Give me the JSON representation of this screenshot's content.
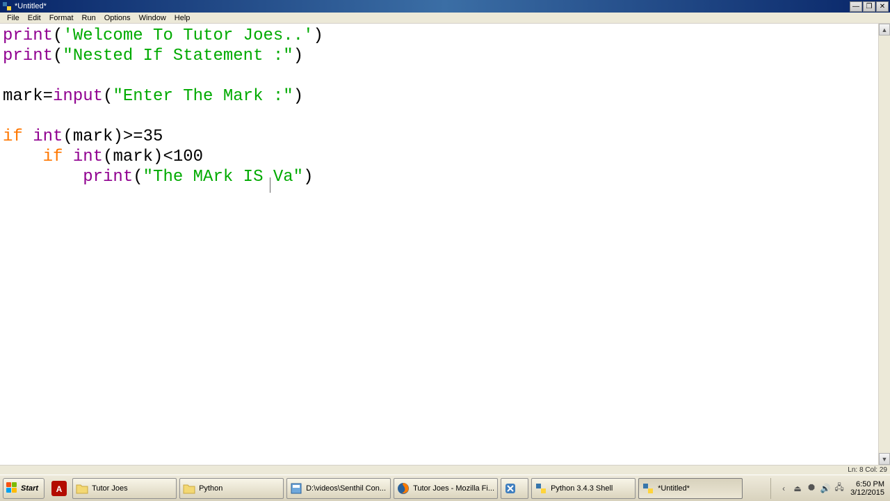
{
  "window": {
    "title": "*Untitled*"
  },
  "menu": {
    "file": "File",
    "edit": "Edit",
    "format": "Format",
    "run": "Run",
    "options": "Options",
    "window": "Window",
    "help": "Help"
  },
  "code": {
    "l1a": "print",
    "l1b": "(",
    "l1c": "'Welcome To Tutor Joes..'",
    "l1d": ")",
    "l2a": "print",
    "l2b": "(",
    "l2c": "\"Nested If Statement :\"",
    "l2d": ")",
    "l3": "",
    "l4a": "mark=",
    "l4b": "input",
    "l4c": "(",
    "l4d": "\"Enter The Mark :\"",
    "l4e": ")",
    "l5": "",
    "l6a": "if",
    "l6b": " ",
    "l6c": "int",
    "l6d": "(mark)>=35",
    "l7a": "    ",
    "l7b": "if",
    "l7c": " ",
    "l7d": "int",
    "l7e": "(mark)<100",
    "l8a": "        ",
    "l8b": "print",
    "l8c": "(",
    "l8d": "\"The MArk IS Va\"",
    "l8e": ")"
  },
  "status": "Ln: 8 Col: 29",
  "taskbar": {
    "start": "Start",
    "items": [
      "Tutor Joes",
      "Python",
      "D:\\videos\\Senthil Con...",
      "Tutor Joes - Mozilla Fi...",
      "",
      "Python 3.4.3 Shell",
      "*Untitled*"
    ],
    "time": "6:50 PM",
    "date": "3/12/2015"
  }
}
